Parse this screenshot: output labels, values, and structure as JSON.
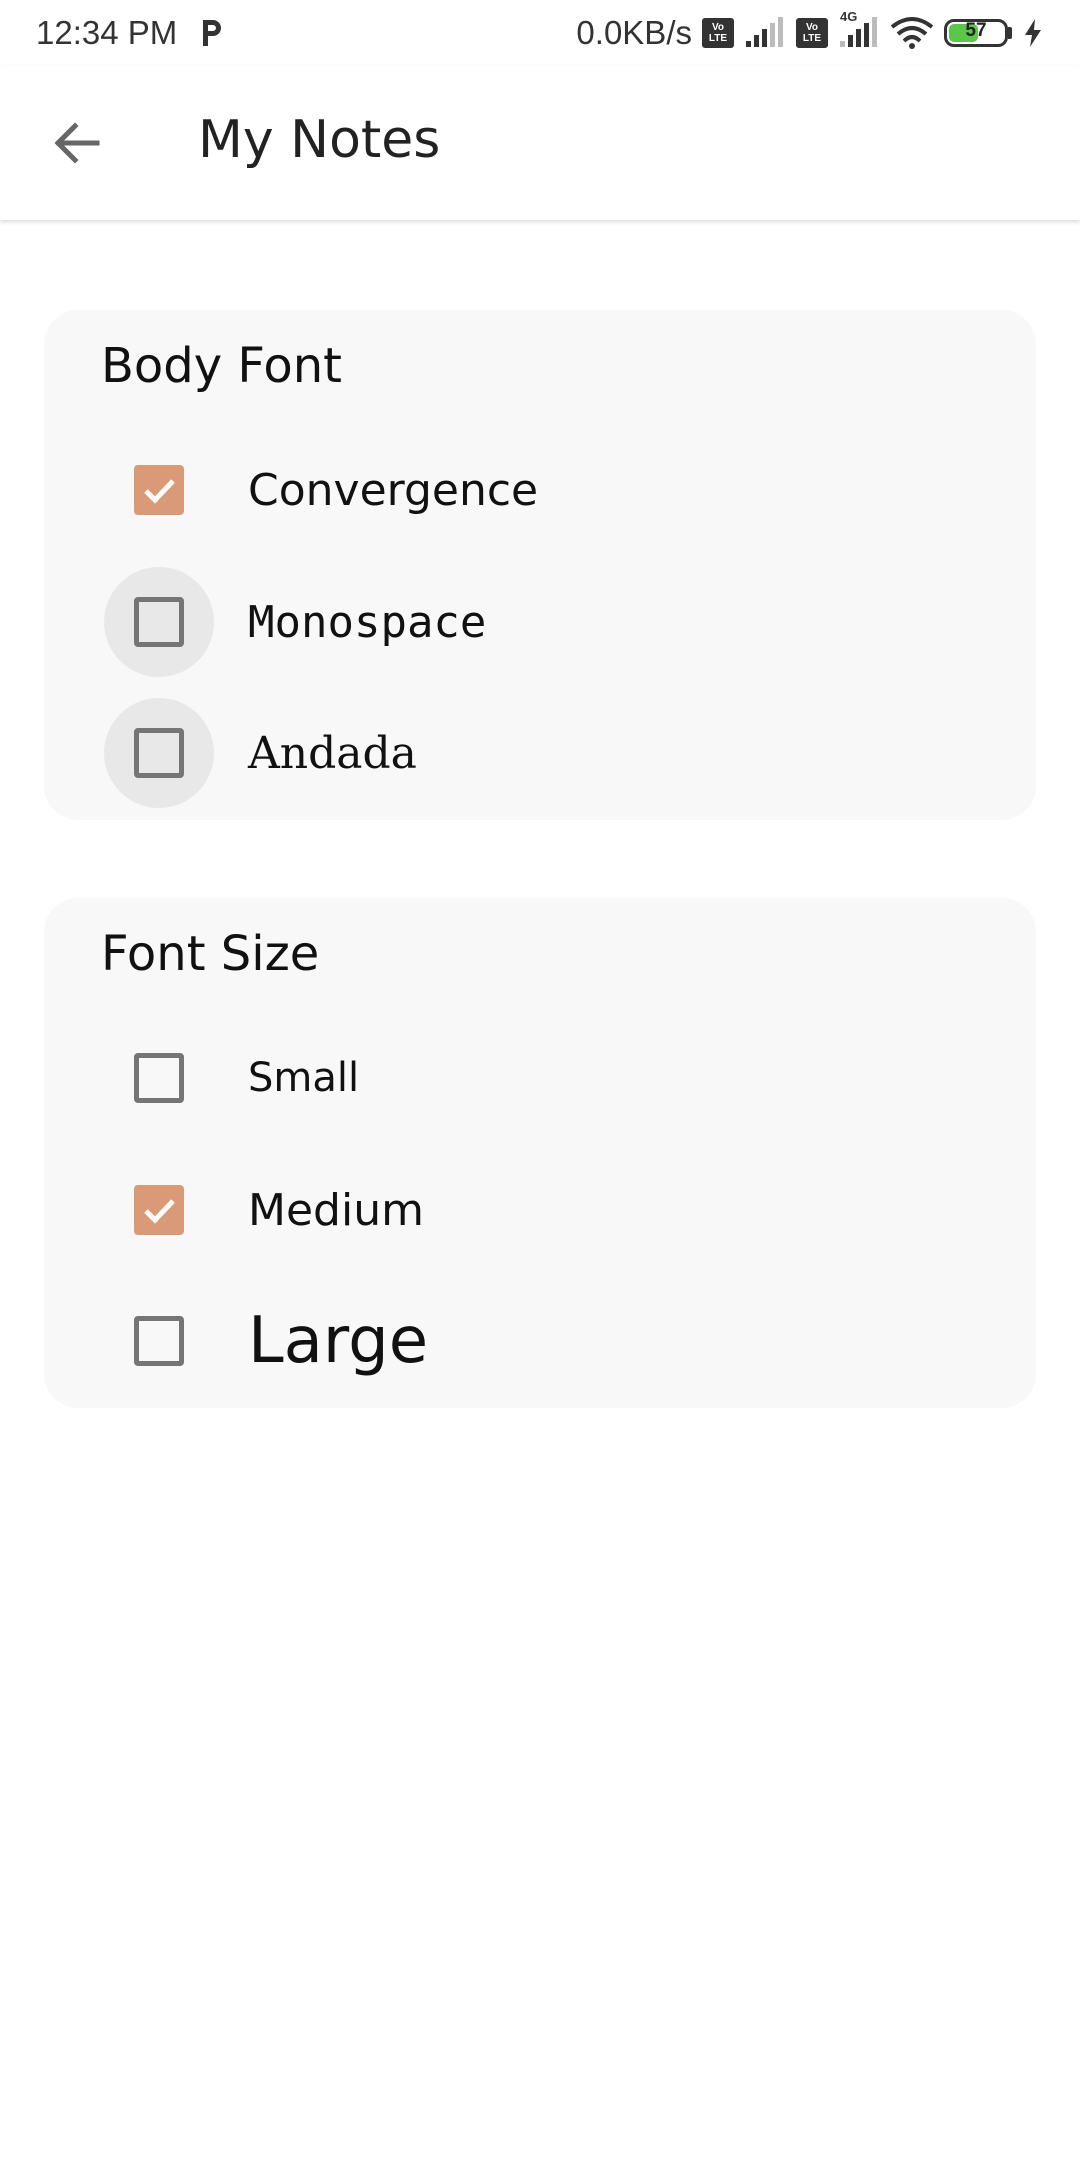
{
  "status_bar": {
    "time": "12:34 PM",
    "network_speed": "0.0KB/s",
    "lte_badge": "Vo\nLTE",
    "network_type": "4G",
    "battery_level": "57",
    "battery_fraction": 0.57,
    "icons": [
      "p-app-icon",
      "volte-icon",
      "signal-icon",
      "volte-icon",
      "signal-icon",
      "wifi-icon",
      "battery-icon",
      "charging-icon"
    ]
  },
  "app_bar": {
    "title": "My Notes"
  },
  "body_font": {
    "title": "Body Font",
    "options": [
      {
        "label": "Convergence",
        "checked": true
      },
      {
        "label": "Monospace",
        "checked": false
      },
      {
        "label": "Andada",
        "checked": false
      }
    ]
  },
  "font_size": {
    "title": "Font Size",
    "options": [
      {
        "label": "Small",
        "checked": false
      },
      {
        "label": "Medium",
        "checked": true
      },
      {
        "label": "Large",
        "checked": false
      }
    ]
  },
  "colors": {
    "accent": "#db9a77",
    "card_background": "#f8f8f8",
    "checkbox_border": "#757575",
    "battery_fill": "#5cc64a"
  }
}
